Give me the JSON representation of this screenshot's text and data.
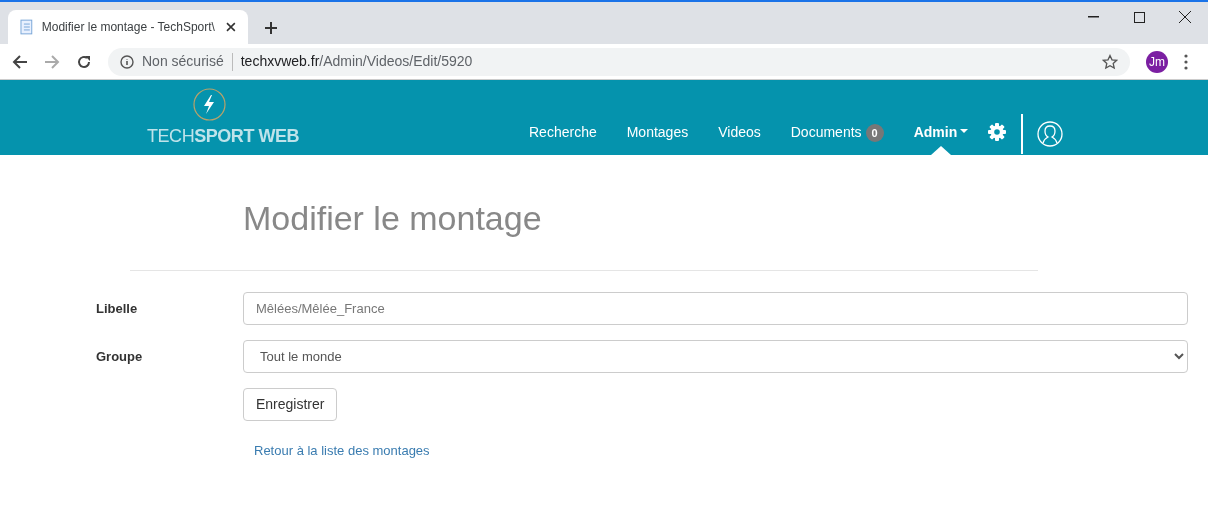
{
  "browser": {
    "tab_title": "Modifier le montage - TechSport\\",
    "security": "Non sécurisé",
    "url_host": "techxvweb.fr",
    "url_path": "/Admin/Videos/Edit/5920",
    "profile": "Jm"
  },
  "navbar": {
    "logo": "TECH**SPORT WEB**",
    "items": [
      {
        "label": "Recherche",
        "selected": false
      },
      {
        "label": "Montages",
        "selected": false
      },
      {
        "label": "Videos",
        "selected": false
      },
      {
        "label": "Documents",
        "badge": "0",
        "selected": false
      },
      {
        "label": "Admin",
        "dropdown": true,
        "selected": true
      }
    ]
  },
  "page": {
    "title": "Modifier le montage",
    "fields": [
      {
        "kind": "text",
        "label": "Libelle",
        "value": "Mêlées/Mêlée_France"
      },
      {
        "kind": "select",
        "label": "Groupe",
        "value": "Tout le monde"
      }
    ],
    "save_button": "Enregistrer",
    "back_link": "Retour à la liste des montages"
  }
}
